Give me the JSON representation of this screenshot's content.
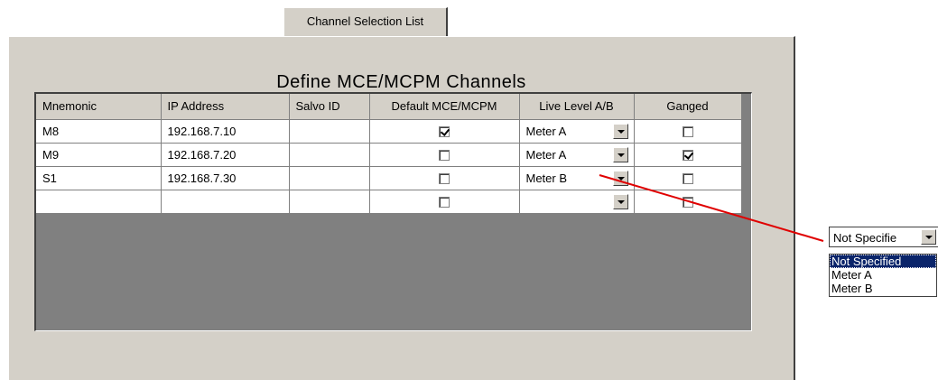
{
  "tab": {
    "label": "Channel Selection List"
  },
  "panel": {
    "title": "Define MCE/MCPM Channels"
  },
  "table": {
    "columns": [
      "Mnemonic",
      "IP Address",
      "Salvo ID",
      "Default MCE/MCPM",
      "Live Level A/B",
      "Ganged"
    ],
    "rows": [
      {
        "mnemonic": "M8",
        "ip": "192.168.7.10",
        "salvo": "",
        "default_checked": true,
        "live_level": "Meter A",
        "ganged_checked": false
      },
      {
        "mnemonic": "M9",
        "ip": "192.168.7.20",
        "salvo": "",
        "default_checked": false,
        "live_level": "Meter A",
        "ganged_checked": true
      },
      {
        "mnemonic": "S1",
        "ip": "192.168.7.30",
        "salvo": "",
        "default_checked": false,
        "live_level": "Meter B",
        "ganged_checked": false
      },
      {
        "mnemonic": "",
        "ip": "",
        "salvo": "",
        "default_checked": false,
        "live_level": "",
        "ganged_checked": false
      }
    ]
  },
  "callout": {
    "combo_value": "Not Specifie",
    "options": [
      "Not Specified",
      "Meter A",
      "Meter B"
    ],
    "selected_option": "Not Specified",
    "line_color": "#e00000"
  },
  "colors": {
    "panel_bg": "#d4d0c8",
    "grid_empty_bg": "#808080",
    "selection_bg": "#0a246a"
  }
}
